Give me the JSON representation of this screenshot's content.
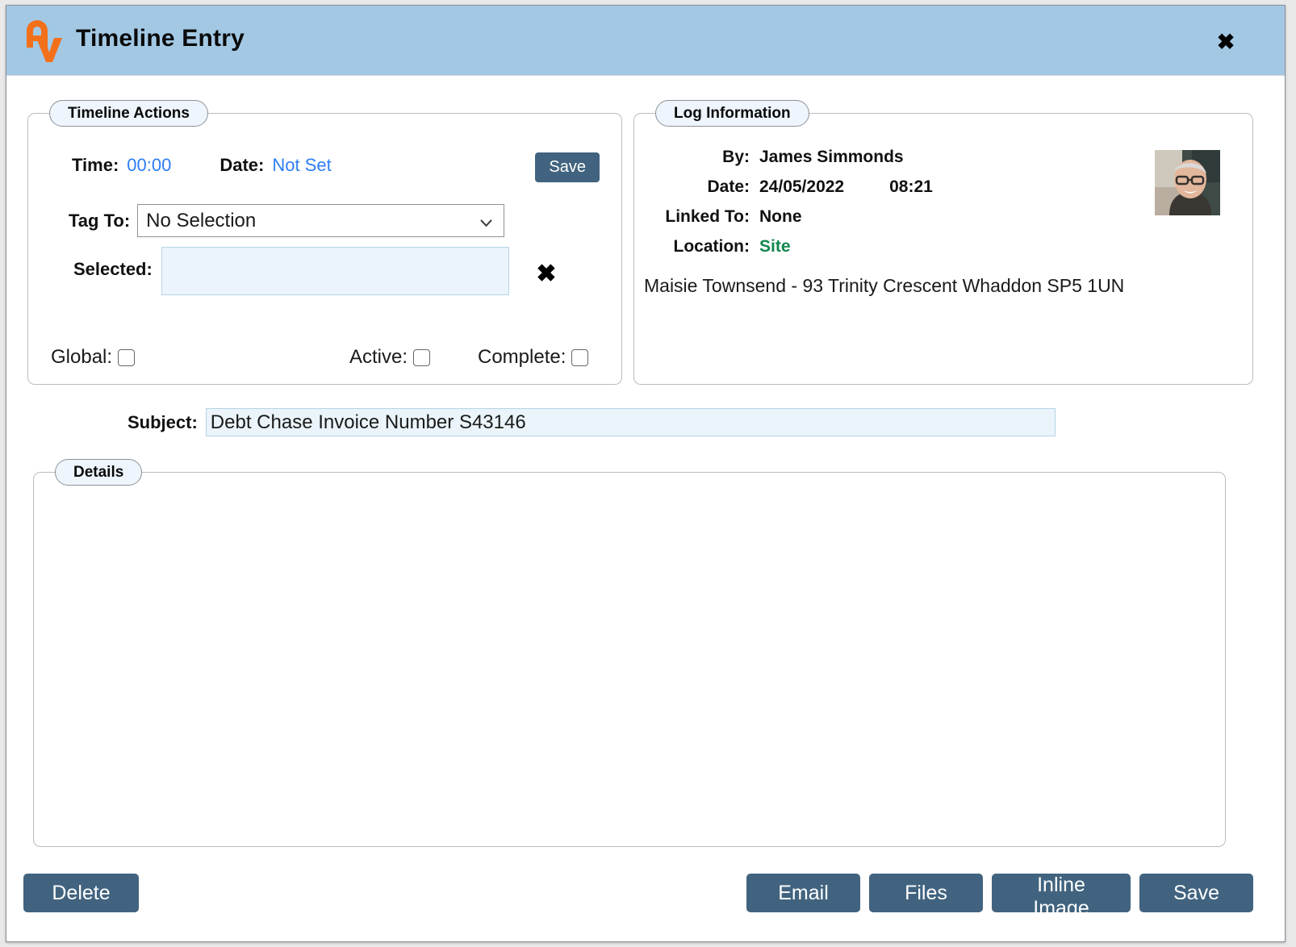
{
  "window": {
    "title": "Timeline Entry",
    "logo_icon": "av-logo-icon",
    "close_icon": "close-icon",
    "header_color": "#a3c8e4",
    "accent_button_color": "#41637f",
    "link_color": "#2d7ef5",
    "location_color": "#12874e"
  },
  "timeline_actions": {
    "legend": "Timeline Actions",
    "time_label": "Time:",
    "time_value": "00:00",
    "date_label": "Date:",
    "date_value": "Not Set",
    "save_label": "Save",
    "tag_to_label": "Tag To:",
    "tag_to_value": "No Selection",
    "tag_to_options": [
      "No Selection"
    ],
    "selected_label": "Selected:",
    "selected_value": "",
    "selected_placeholder": "",
    "clear_icon": "clear-x-icon",
    "checkboxes": [
      {
        "label": "Global:",
        "checked": false
      },
      {
        "label": "Active:",
        "checked": false
      },
      {
        "label": "Complete:",
        "checked": false
      }
    ]
  },
  "log_information": {
    "legend": "Log Information",
    "by_label": "By:",
    "by_value": "James Simmonds",
    "date_label": "Date:",
    "date_value": "24/05/2022",
    "time_value": "08:21",
    "linked_to_label": "Linked To:",
    "linked_to_value": "None",
    "location_label": "Location:",
    "location_value": "Site",
    "address": "Maisie Townsend - 93 Trinity Crescent Whaddon SP5 1UN",
    "avatar_icon": "user-avatar-photo"
  },
  "subject": {
    "label": "Subject:",
    "value": "Debt Chase Invoice Number S43146",
    "placeholder": ""
  },
  "details": {
    "legend": "Details",
    "body": ""
  },
  "footer": {
    "delete_label": "Delete",
    "email_label": "Email",
    "files_label": "Files",
    "inline_image_label": "Inline Image",
    "save_label": "Save"
  }
}
